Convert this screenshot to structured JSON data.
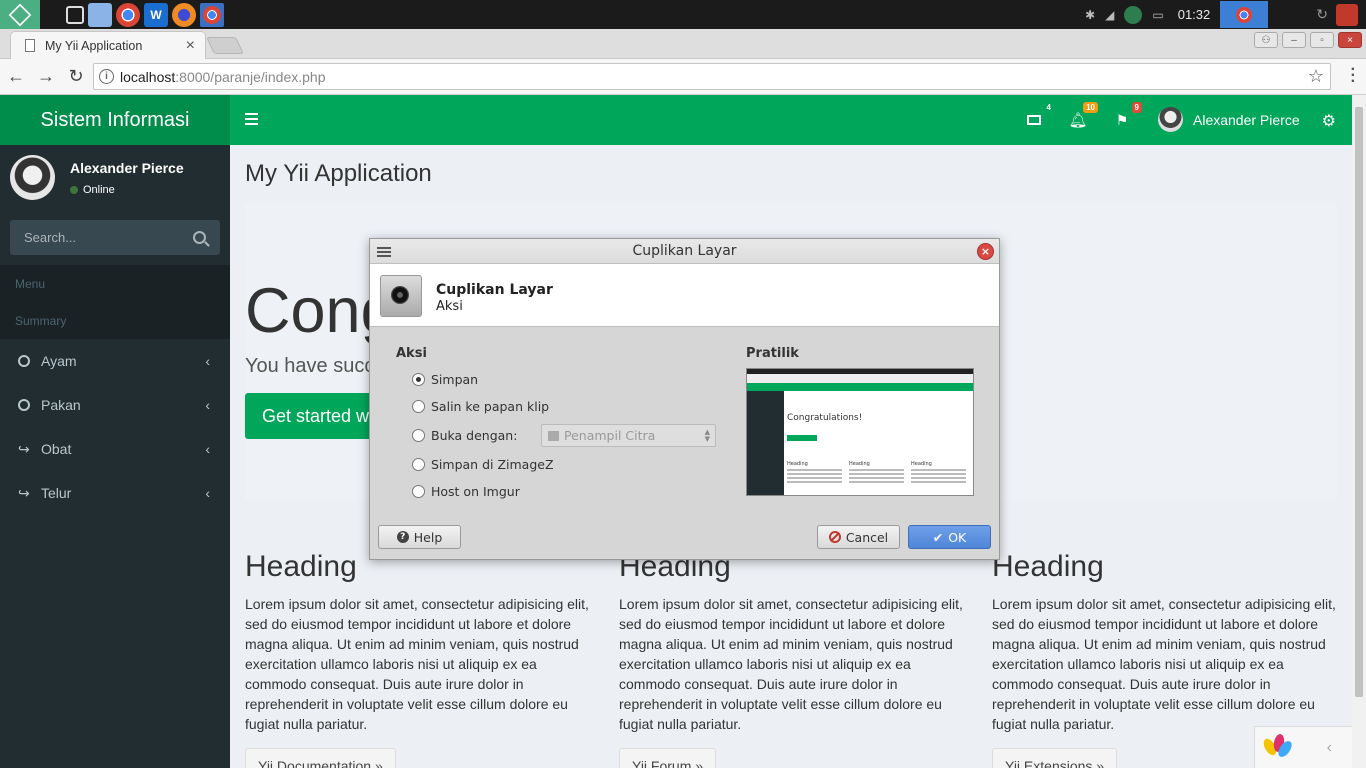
{
  "taskbar": {
    "clock": "01:32",
    "apps": [
      "terminal",
      "files",
      "chrome",
      "wps-writer",
      "firefox",
      "chrome-active"
    ]
  },
  "browser": {
    "tab_title": "My Yii Application",
    "tab_close": "×",
    "url_host": "localhost",
    "url_rest": ":8000/paranje/index.php"
  },
  "app": {
    "logo": "Sistem Informasi",
    "navbar": {
      "messages_count": "4",
      "notifications_count": "10",
      "tasks_count": "9",
      "user_name": "Alexander Pierce"
    },
    "sidebar": {
      "user_name": "Alexander Pierce",
      "status": "Online",
      "search_placeholder": "Search...",
      "headers": [
        "Menu",
        "Summary"
      ],
      "items": [
        {
          "label": "Ayam",
          "icon": "circle-o-icon"
        },
        {
          "label": "Pakan",
          "icon": "circle-o-icon"
        },
        {
          "label": "Obat",
          "icon": "share-icon"
        },
        {
          "label": "Telur",
          "icon": "share-icon"
        }
      ]
    },
    "content": {
      "title": "My Yii Application",
      "jumbotron_heading": "Cong",
      "jumbotron_text": "You have succe",
      "jumbotron_button": "Get started wit",
      "columns": [
        {
          "heading": "Heading",
          "text": "Lorem ipsum dolor sit amet, consectetur adipisicing elit, sed do eiusmod tempor incididunt ut labore et dolore magna aliqua. Ut enim ad minim veniam, quis nostrud exercitation ullamco laboris nisi ut aliquip ex ea commodo consequat. Duis aute irure dolor in reprehenderit in voluptate velit esse cillum dolore eu fugiat nulla pariatur.",
          "button": "Yii Documentation »"
        },
        {
          "heading": "Heading",
          "text": "Lorem ipsum dolor sit amet, consectetur adipisicing elit, sed do eiusmod tempor incididunt ut labore et dolore magna aliqua. Ut enim ad minim veniam, quis nostrud exercitation ullamco laboris nisi ut aliquip ex ea commodo consequat. Duis aute irure dolor in reprehenderit in voluptate velit esse cillum dolore eu fugiat nulla pariatur.",
          "button": "Yii Forum »"
        },
        {
          "heading": "Heading",
          "text": "Lorem ipsum dolor sit amet, consectetur adipisicing elit, sed do eiusmod tempor incididunt ut labore et dolore magna aliqua. Ut enim ad minim veniam, quis nostrud exercitation ullamco laboris nisi ut aliquip ex ea commodo consequat. Duis aute irure dolor in reprehenderit in voluptate velit esse cillum dolore eu fugiat nulla pariatur.",
          "button": "Yii Extensions »"
        }
      ]
    }
  },
  "dialog": {
    "window_title": "Cuplikan Layar",
    "header_title": "Cuplikan Layar",
    "header_subtitle": "Aksi",
    "actions_label": "Aksi",
    "options": [
      {
        "label": "Simpan",
        "checked": true
      },
      {
        "label": "Salin ke papan klip",
        "checked": false
      },
      {
        "label": "Buka dengan:",
        "checked": false
      },
      {
        "label": "Simpan di ZimageZ",
        "checked": false
      },
      {
        "label": "Host on Imgur",
        "checked": false
      }
    ],
    "open_with_value": "Penampil Citra",
    "preview_label": "Pratilik",
    "preview_title": "Congratulations!",
    "preview_headings": [
      "Heading",
      "Heading",
      "Heading"
    ],
    "help_button": "Help",
    "cancel_button": "Cancel",
    "ok_button": "OK"
  },
  "colors": {
    "green": "#00a65a",
    "green_dark": "#008d4c",
    "sidebar": "#222d32"
  }
}
